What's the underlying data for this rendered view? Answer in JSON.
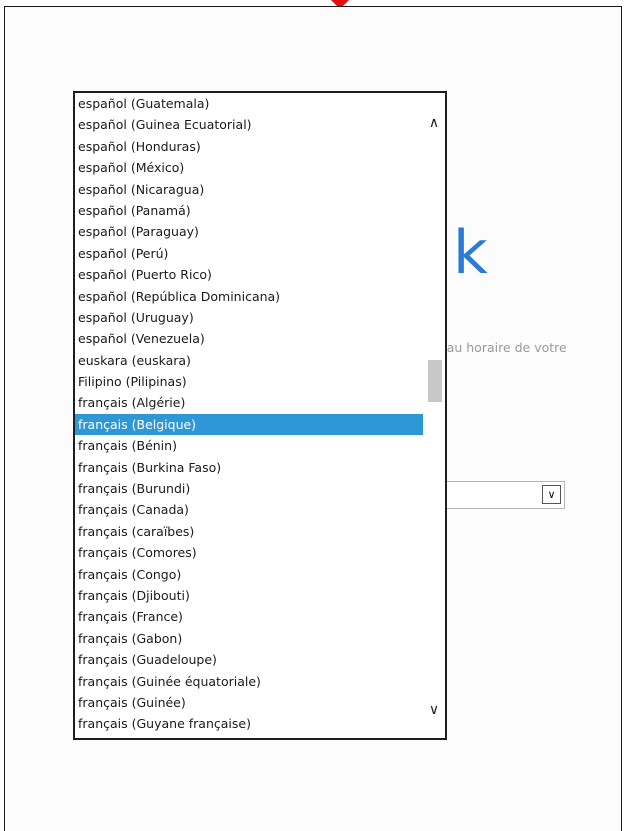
{
  "background": {
    "glyph": "k",
    "text": "eau horaire de votre"
  },
  "colors": {
    "accent": "#2e98d6",
    "marker": "#e01010",
    "glyph": "#2b7bd6"
  },
  "dropdown": {
    "selected": "français (Belgique)",
    "options": [
      "español (Guatemala)",
      "español (Guinea Ecuatorial)",
      "español (Honduras)",
      "español (México)",
      "español (Nicaragua)",
      "español (Panamá)",
      "español (Paraguay)",
      "español (Perú)",
      "español (Puerto Rico)",
      "español (República Dominicana)",
      "español (Uruguay)",
      "español (Venezuela)",
      "euskara (euskara)",
      "Filipino (Pilipinas)",
      "français (Algérie)",
      "français (Belgique)",
      "français (Bénin)",
      "français (Burkina Faso)",
      "français (Burundi)",
      "français (Canada)",
      "français (caraïbes)",
      "français (Comores)",
      "français (Congo)",
      "français (Djibouti)",
      "français (France)",
      "français (Gabon)",
      "français (Guadeloupe)",
      "français (Guinée équatoriale)",
      "français (Guinée)",
      "français (Guyane française)"
    ]
  }
}
